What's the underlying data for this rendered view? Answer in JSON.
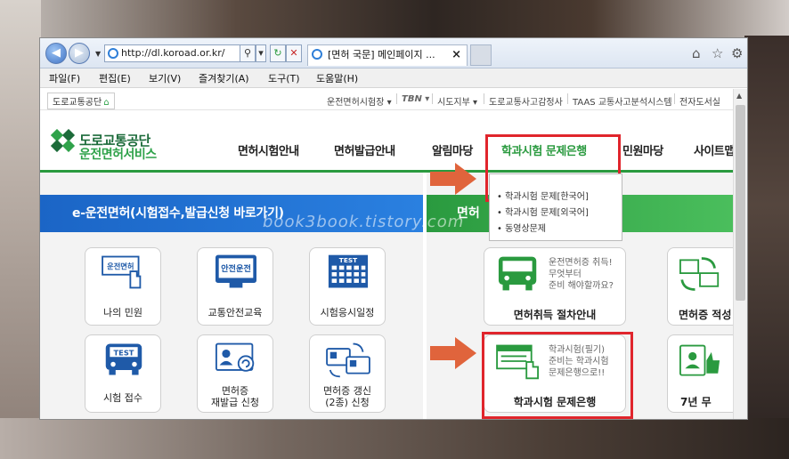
{
  "browser": {
    "url": "http://dl.koroad.or.kr/",
    "tab_title": "[면허 국문] 메인페이지 ...",
    "tab_close": "×",
    "url_controls": [
      "⚲",
      "▾"
    ],
    "refresh": "↻",
    "stop": "✕",
    "right_icons": [
      "⌂",
      "☆",
      "⚙"
    ]
  },
  "menu": {
    "items": [
      "파일(F)",
      "편집(E)",
      "보기(V)",
      "즐겨찾기(A)",
      "도구(T)",
      "도움말(H)"
    ]
  },
  "site": {
    "util": {
      "home": "도로교통공단",
      "home_icon": "⌂",
      "links": [
        "운전면허시험장 ▾",
        "TBN ▾",
        "시도지부 ▾",
        "도로교통사고감정사",
        "TAAS 교통사고분석시스템",
        "전자도서실"
      ]
    },
    "logo": {
      "line1": "도로교통공단",
      "line2": "운전면허서비스"
    },
    "nav": [
      "면허시험안내",
      "면허발급안내",
      "알림마당",
      "학과시험 문제은행",
      "민원마당",
      "사이트맵"
    ],
    "dropdown": [
      "• 학과시험 문제[한국어]",
      "• 학과시험 문제[외국어]",
      "• 동영상문제"
    ],
    "blue_banner": "e-운전면허(시험접수,발급신청 바로가기)",
    "green_banner": "면허",
    "watermark": "book3book.tistory.com",
    "left_cards": [
      {
        "label": "나의 민원",
        "icon_text": "운전면허"
      },
      {
        "label": "교통안전교육",
        "icon_text": "안전운전"
      },
      {
        "label": "시험응시일정",
        "icon_text": "TEST"
      },
      {
        "label": "시험 접수",
        "icon_text": "TEST"
      },
      {
        "label": "면허증\n재발급 신청",
        "icon_text": ""
      },
      {
        "label": "면허증 갱신\n(2종) 신청",
        "icon_text": ""
      }
    ],
    "right_cards": [
      {
        "label": "면허취득 절차안내",
        "note": "운전면허증 취득!\n무엇부터\n준비 해야할까요?"
      },
      {
        "label": "면허증 적성",
        "note": ""
      },
      {
        "label": "학과시험 문제은행",
        "note": "학과시험(필기)\n준비는 학과시험\n문제은행으로!!"
      },
      {
        "label": "7년 무",
        "note": ""
      }
    ]
  },
  "colors": {
    "site_green": "#2a9a3f",
    "banner_blue": "#1b65c6",
    "highlight_red": "#e0252c",
    "arrow_orange": "#e0643c"
  }
}
